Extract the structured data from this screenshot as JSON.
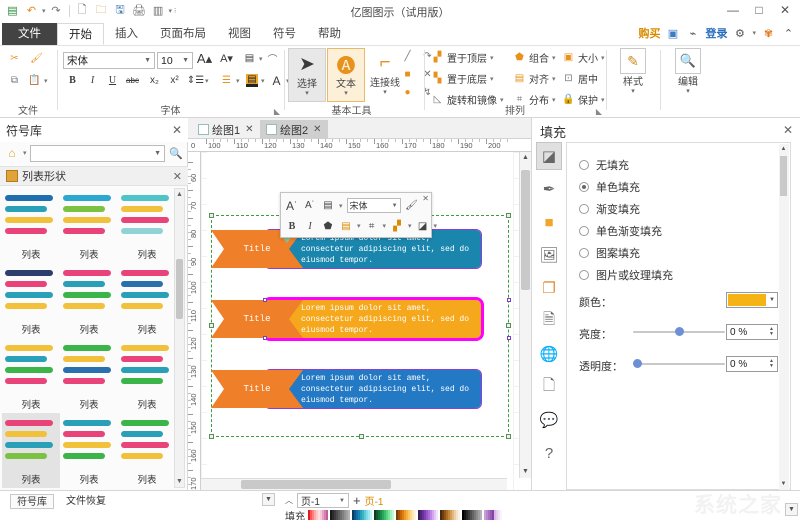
{
  "window": {
    "title": "亿图图示（试用版）",
    "minimize": "—",
    "maximize": "□",
    "close": "✕"
  },
  "quick_access": [
    "app-logo",
    "undo",
    "redo",
    "new",
    "open",
    "save",
    "print",
    "export"
  ],
  "menu": {
    "file": "文件",
    "tabs": [
      "开始",
      "插入",
      "页面布局",
      "视图",
      "符号",
      "帮助"
    ],
    "active": "开始"
  },
  "top_right": {
    "buy": "购买",
    "icons": [
      "share-box-icon",
      "share-icon",
      "settings-icon",
      "app-icon",
      "collapse-icon"
    ],
    "login": "登录"
  },
  "ribbon": {
    "groups": [
      {
        "name": "文件"
      },
      {
        "name": "字体"
      },
      {
        "name": "基本工具"
      },
      {
        "name": "排列"
      },
      {
        "name": "样式"
      },
      {
        "name": "编辑"
      }
    ],
    "clipboard": {
      "cut": "剪切",
      "format_painter": "格式刷",
      "copy": "复制",
      "paste": "粘贴"
    },
    "font": {
      "family": "宋体",
      "size": "10",
      "grow": "A",
      "shrink": "A",
      "bold": "B",
      "italic": "I",
      "underline": "U",
      "strike": "abc",
      "subscript": "x₂",
      "superscript": "x²"
    },
    "tools": {
      "select": "选择",
      "text": "文本",
      "connector": "连接线"
    },
    "arrange": {
      "bring_front": "置于顶层",
      "send_back": "置于底层",
      "rotate_flip": "旋转和镜像",
      "group": "组合",
      "align": "对齐",
      "distribute": "分布",
      "size": "大小",
      "center": "居中",
      "protect": "保护"
    },
    "style": "样式",
    "edit": "编辑"
  },
  "left_panel": {
    "title": "符号库",
    "search_placeholder": "",
    "section": "列表形状",
    "shape_label": "列表",
    "shape_count": 12
  },
  "canvas": {
    "tabs": [
      {
        "label": "绘图1",
        "active": false
      },
      {
        "label": "绘图2",
        "active": true
      }
    ],
    "ruler_h": [
      "100",
      "110",
      "120",
      "130",
      "140",
      "150",
      "160",
      "170",
      "180",
      "190",
      "200"
    ],
    "ruler_v": [
      "60",
      "70",
      "80",
      "90",
      "100",
      "110",
      "120",
      "130",
      "140",
      "150",
      "160",
      "170"
    ],
    "mini_toolbar": {
      "font": "宋体",
      "grow": "A",
      "shrink": "A",
      "bold": "B",
      "italic": "I"
    },
    "items": [
      {
        "title": "Title",
        "body": "Lorem ipsum dolor sit amet, consectetur adipiscing elit, sed do eiusmod tempor.",
        "body_color": "#1b86ad",
        "tag_color": "#ef7f28",
        "selected": false
      },
      {
        "title": "Title",
        "body": "Lorem ipsum dolor sit amet, consectetur adipiscing elit, sed do eiusmod tempor.",
        "body_color": "#f5a81c",
        "tag_color": "#ef7f28",
        "selected": true
      },
      {
        "title": "Title",
        "body": "Lorem ipsum dolor sit amet, consectetur adipiscing elit, sed do eiusmod tempor.",
        "body_color": "#2379c4",
        "tag_color": "#ef7f28",
        "selected": false
      }
    ]
  },
  "right_panel": {
    "title": "填充",
    "icons": [
      "fill-icon",
      "line-icon",
      "color-icon",
      "image-icon",
      "shadow-icon",
      "page-icon",
      "globe-icon",
      "document-icon",
      "comment-icon",
      "help-icon"
    ],
    "fill_options": [
      {
        "label": "无填充",
        "selected": false
      },
      {
        "label": "单色填充",
        "selected": true
      },
      {
        "label": "渐变填充",
        "selected": false
      },
      {
        "label": "单色渐变填充",
        "selected": false
      },
      {
        "label": "图案填充",
        "selected": false
      },
      {
        "label": "图片或纹理填充",
        "selected": false
      }
    ],
    "color_label": "颜色：",
    "color_value": "#f5b316",
    "brightness_label": "亮度：",
    "brightness_value": "0 %",
    "brightness_pct": 50,
    "transparency_label": "透明度：",
    "transparency_value": "0 %",
    "transparency_pct": 0
  },
  "status_bar": {
    "left_tabs": [
      "符号库",
      "文件恢复"
    ],
    "page_label": "页-1",
    "page_name": "页-1",
    "add_page": "+",
    "fill_label": "填充",
    "watermark": "系统之家"
  }
}
